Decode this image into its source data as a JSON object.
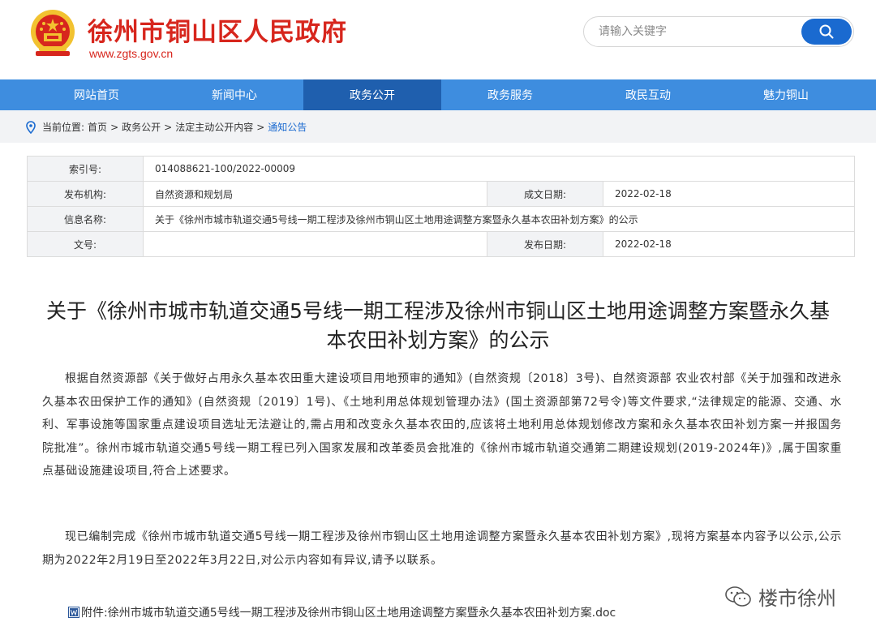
{
  "header": {
    "site_title": "徐州市铜山区人民政府",
    "site_url": "www.zgts.gov.cn",
    "search_placeholder": "请输入关键字"
  },
  "colors": {
    "brand_red": "#d7261d",
    "nav_blue": "#3e8ddf",
    "nav_active": "#1f5fae",
    "link_blue": "#1a6ad0"
  },
  "nav": {
    "items": [
      {
        "label": "网站首页"
      },
      {
        "label": "新闻中心"
      },
      {
        "label": "政务公开",
        "active": true
      },
      {
        "label": "政务服务"
      },
      {
        "label": "政民互动"
      },
      {
        "label": "魅力铜山"
      }
    ]
  },
  "breadcrumb": {
    "prefix": "当前位置:",
    "items": [
      "首页",
      "政务公开",
      "法定主动公开内容",
      "通知公告"
    ],
    "sep": ">"
  },
  "info": {
    "index_label": "索引号:",
    "index_value": "014088621-100/2022-00009",
    "publisher_label": "发布机构:",
    "publisher_value": "自然资源和规划局",
    "created_label": "成文日期:",
    "created_value": "2022-02-18",
    "name_label": "信息名称:",
    "name_value": "关于《徐州市城市轨道交通5号线一期工程涉及徐州市铜山区土地用途调整方案暨永久基本农田补划方案》的公示",
    "docno_label": "文号:",
    "docno_value": "",
    "published_label": "发布日期:",
    "published_value": "2022-02-18"
  },
  "article": {
    "title_line1": "关于《徐州市城市轨道交通5号线一期工程涉及徐州市铜山区土地用途调整方案暨永久基",
    "title_line2": "本农田补划方案》的公示",
    "para1": "根据自然资源部《关于做好占用永久基本农田重大建设项目用地预审的通知》(自然资规〔2018〕3号)、自然资源部 农业农村部《关于加强和改进永久基本农田保护工作的通知》(自然资规〔2019〕1号)、《土地利用总体规划管理办法》(国土资源部第72号令)等文件要求,“法律规定的能源、交通、水利、军事设施等国家重点建设项目选址无法避让的,需占用和改变永久基本农田的,应该将土地利用总体规划修改方案和永久基本农田补划方案一并报国务院批准”。徐州市城市轨道交通5号线一期工程已列入国家发展和改革委员会批准的《徐州市城市轨道交通第二期建设规划(2019-2024年)》,属于国家重点基础设施建设项目,符合上述要求。",
    "para2": "现已编制完成《徐州市城市轨道交通5号线一期工程涉及徐州市铜山区土地用途调整方案暨永久基本农田补划方案》,现将方案基本内容予以公示,公示期为2022年2月19日至2022年3月22日,对公示内容如有异议,请予以联系。",
    "attachment": "附件:徐州市城市轨道交通5号线一期工程涉及徐州市铜山区土地用途调整方案暨永久基本农田补划方案.doc"
  },
  "watermark": {
    "text": "楼市徐州",
    "icon": "wechat-icon"
  }
}
